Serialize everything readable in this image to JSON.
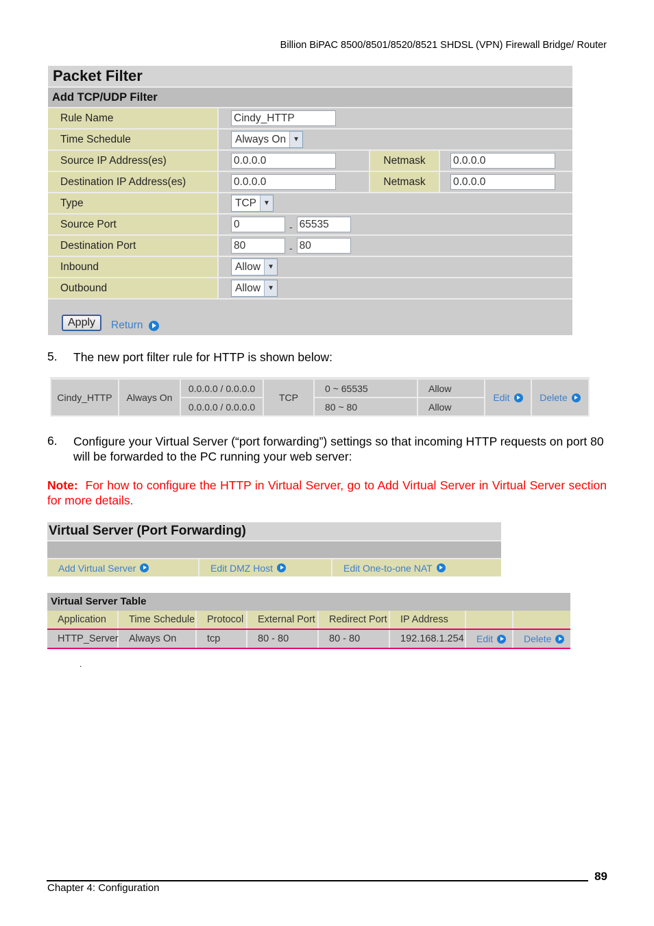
{
  "header": {
    "running_title": "Billion BiPAC 8500/8501/8520/8521 SHDSL (VPN) Firewall Bridge/ Router"
  },
  "packet_filter": {
    "title": "Packet Filter",
    "subtitle": "Add TCP/UDP Filter",
    "fields": {
      "rule_name": {
        "label": "Rule Name",
        "value": "Cindy_HTTP"
      },
      "time_schedule": {
        "label": "Time Schedule",
        "value": "Always On"
      },
      "source_ip": {
        "label": "Source IP Address(es)",
        "value": "0.0.0.0",
        "netmask_label": "Netmask",
        "netmask": "0.0.0.0"
      },
      "destination_ip": {
        "label": "Destination IP Address(es)",
        "value": "0.0.0.0",
        "netmask_label": "Netmask",
        "netmask": "0.0.0.0"
      },
      "type": {
        "label": "Type",
        "value": "TCP"
      },
      "source_port": {
        "label": "Source Port",
        "from": "0",
        "to": "65535",
        "separator": "-"
      },
      "destination_port": {
        "label": "Destination Port",
        "from": "80",
        "to": "80",
        "separator": "-"
      },
      "inbound": {
        "label": "Inbound",
        "value": "Allow"
      },
      "outbound": {
        "label": "Outbound",
        "value": "Allow"
      }
    },
    "apply_label": "Apply",
    "return_label": "Return"
  },
  "steps": {
    "step5": {
      "num": "5.",
      "text": "The new port filter rule for HTTP is shown below:"
    },
    "step6": {
      "num": "6.",
      "text": "Configure your Virtual Server (“port forwarding”) settings so that incoming HTTP requests on port 80 will be forwarded to the PC running your web server:"
    }
  },
  "filter_rule": {
    "name": "Cindy_HTTP",
    "schedule": "Always On",
    "source": "0.0.0.0 / 0.0.0.0",
    "destination": "0.0.0.0 / 0.0.0.0",
    "protocol": "TCP",
    "source_port": "0 ~ 65535",
    "destination_port": "80 ~ 80",
    "inbound": "Allow",
    "outbound": "Allow",
    "edit_label": "Edit",
    "delete_label": "Delete"
  },
  "note": {
    "prefix": "Note:",
    "text": "For how to configure the HTTP in Virtual Server, go to Add Virtual Server in Virtual Server section for more details.",
    "color": "#ff0000"
  },
  "virtual_server": {
    "title": "Virtual Server (Port Forwarding)",
    "links": [
      "Add Virtual Server",
      "Edit DMZ Host",
      "Edit One-to-one NAT"
    ]
  },
  "virtual_server_table": {
    "title": "Virtual Server Table",
    "columns": [
      "Application",
      "Time Schedule",
      "Protocol",
      "External Port",
      "Redirect Port",
      "IP Address",
      "",
      ""
    ],
    "rows": [
      {
        "application": "HTTP_Server",
        "schedule": "Always On",
        "protocol": "tcp",
        "external_port": "80 - 80",
        "redirect_port": "80 - 80",
        "ip": "192.168.1.254",
        "edit_label": "Edit",
        "delete_label": "Delete"
      }
    ]
  },
  "stray_mark": ".",
  "footer": {
    "chapter": "Chapter 4: Configuration",
    "page": "89"
  },
  "colors": {
    "label_bg": "#deddb0",
    "panel_bg": "#cccccc",
    "link": "#3c7fc9",
    "row_highlight": "#e8006e"
  }
}
